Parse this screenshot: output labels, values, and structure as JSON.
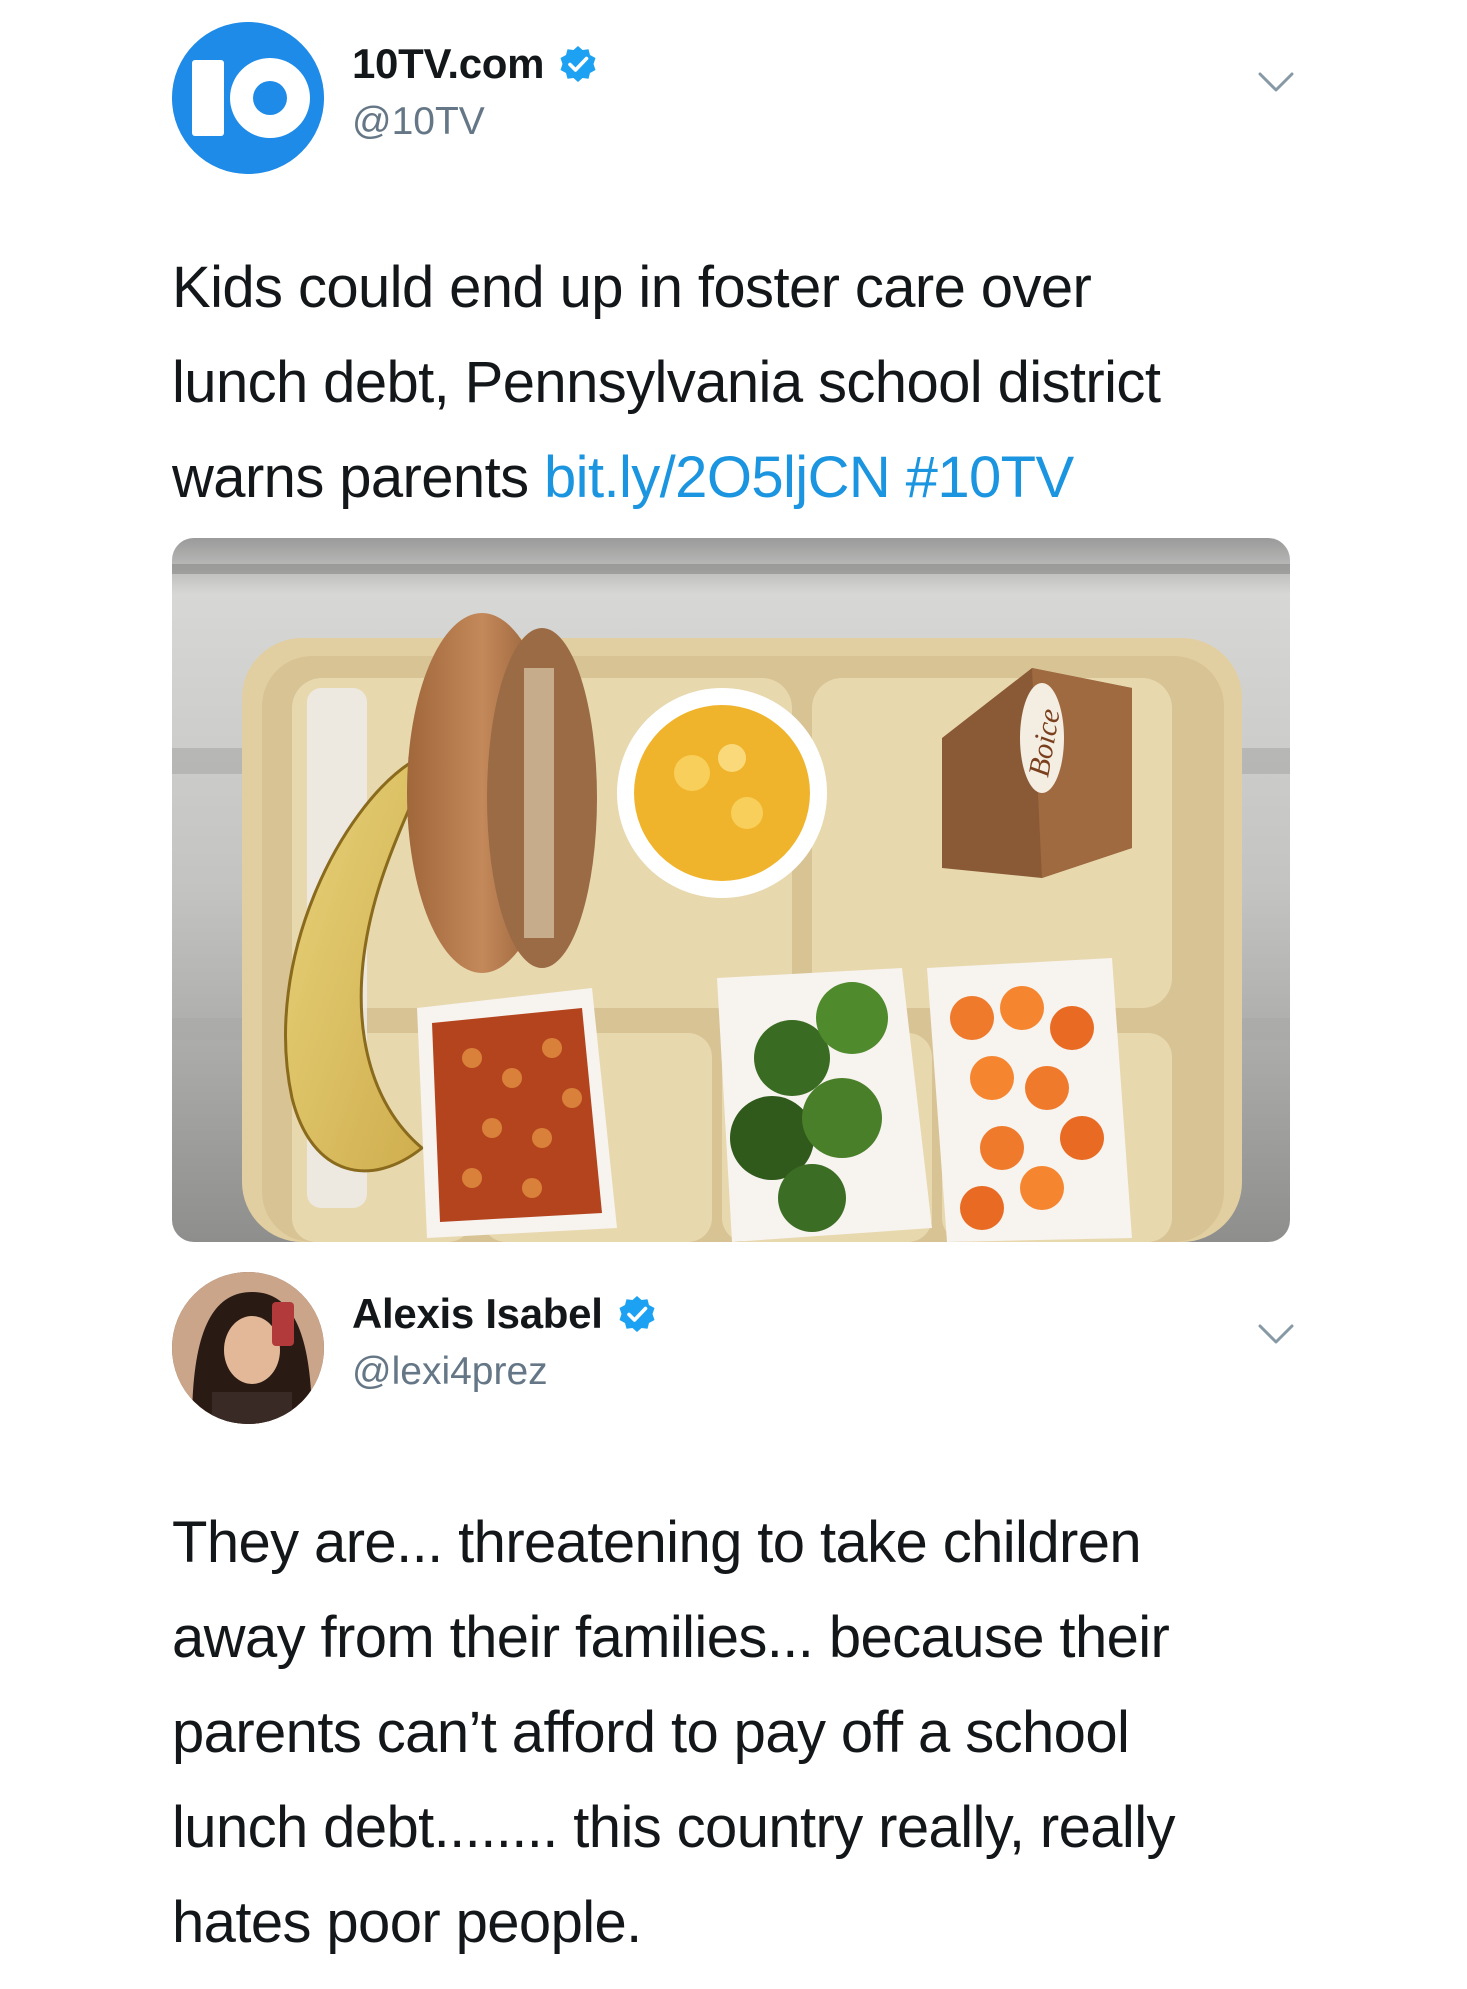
{
  "tweet1": {
    "avatar_logo_text": "10",
    "display_name": "10TV.com",
    "handle": "@10TV",
    "verified_icon": "verified-badge-icon",
    "menu_icon": "chevron-down-icon",
    "text_lines": [
      "Kids could end up in foster care over",
      "lunch debt, Pennsylvania school district",
      "warns parents "
    ],
    "link": "bit.ly/2O5ljCN",
    "hashtag": "#10TV",
    "colors": {
      "link": "#1b95e0",
      "brand_blue": "#1f8be8",
      "verified": "#1da1f2"
    },
    "media": {
      "milk_brand": "Boice"
    }
  },
  "tweet2": {
    "display_name": "Alexis Isabel",
    "handle": "@lexi4prez",
    "verified_icon": "verified-badge-icon",
    "menu_icon": "chevron-down-icon",
    "text_lines": [
      "They are... threatening to take children",
      "away from their families... because their",
      "parents can’t afford to pay off a school",
      "lunch debt........ this country really, really",
      "hates poor people."
    ]
  }
}
